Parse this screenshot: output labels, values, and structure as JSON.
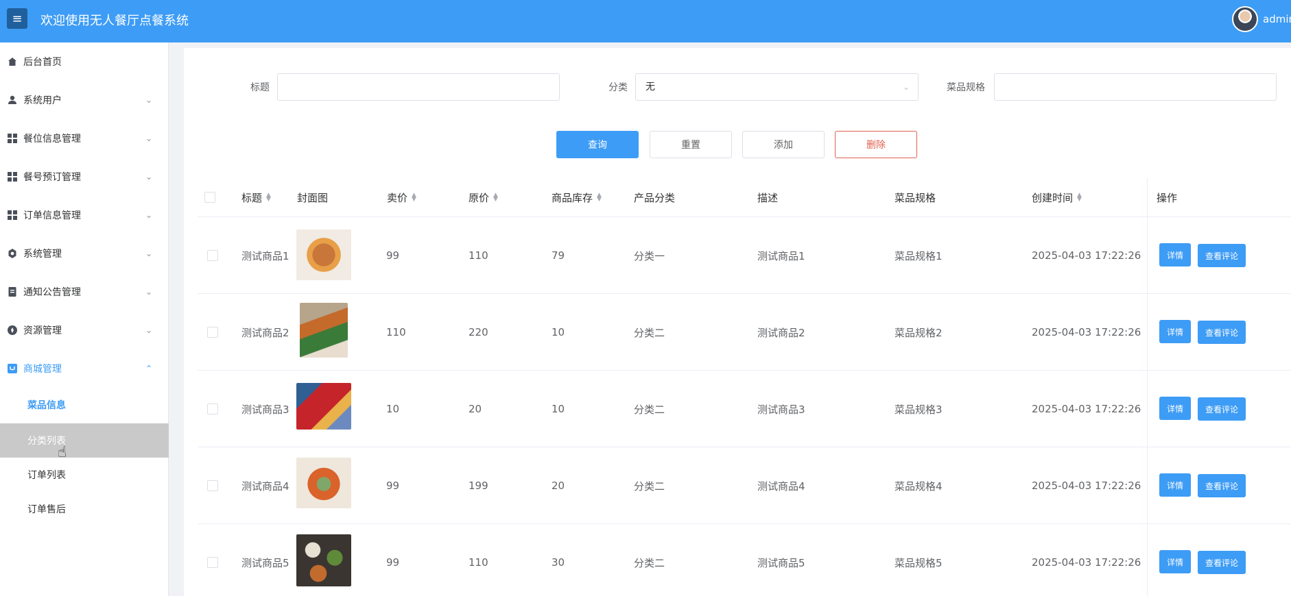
{
  "header": {
    "title": "欢迎使用无人餐厅点餐系统",
    "user": "admin",
    "menu_icon": "hamburger-icon"
  },
  "sidebar": {
    "items": [
      {
        "label": "后台首页",
        "icon": "home-icon",
        "expand": ""
      },
      {
        "label": "系统用户",
        "icon": "user-icon",
        "expand": "⌄"
      },
      {
        "label": "餐位信息管理",
        "icon": "grid-icon",
        "expand": "⌄"
      },
      {
        "label": "餐号预订管理",
        "icon": "grid-icon",
        "expand": "⌄"
      },
      {
        "label": "订单信息管理",
        "icon": "grid-icon",
        "expand": "⌄"
      },
      {
        "label": "系统管理",
        "icon": "gear-icon",
        "expand": "⌄"
      },
      {
        "label": "通知公告管理",
        "icon": "document-icon",
        "expand": "⌄"
      },
      {
        "label": "资源管理",
        "icon": "compass-icon",
        "expand": "⌄"
      },
      {
        "label": "商城管理",
        "icon": "shop-icon",
        "expand": "⌃"
      }
    ],
    "sub_items": [
      {
        "label": "菜品信息"
      },
      {
        "label": "分类列表"
      },
      {
        "label": "订单列表"
      },
      {
        "label": "订单售后"
      }
    ]
  },
  "filters": {
    "title_label": "标题",
    "title_value": "",
    "category_label": "分类",
    "category_value": "无",
    "spec_label": "菜品规格",
    "spec_value": ""
  },
  "actions": {
    "query": "查询",
    "reset": "重置",
    "add": "添加",
    "delete": "删除"
  },
  "table": {
    "columns": [
      "标题",
      "封面图",
      "卖价",
      "原价",
      "商品库存",
      "产品分类",
      "描述",
      "菜品规格",
      "创建时间",
      "操作"
    ],
    "rows": [
      {
        "title": "测试商品1",
        "price": "99",
        "orig": "110",
        "stock": "79",
        "category": "分类一",
        "desc": "测试商品1",
        "spec": "菜品规格1",
        "created": "2025-04-03 17:22:26"
      },
      {
        "title": "测试商品2",
        "price": "110",
        "orig": "220",
        "stock": "10",
        "category": "分类二",
        "desc": "测试商品2",
        "spec": "菜品规格2",
        "created": "2025-04-03 17:22:26"
      },
      {
        "title": "测试商品3",
        "price": "10",
        "orig": "20",
        "stock": "10",
        "category": "分类二",
        "desc": "测试商品3",
        "spec": "菜品规格3",
        "created": "2025-04-03 17:22:26"
      },
      {
        "title": "测试商品4",
        "price": "99",
        "orig": "199",
        "stock": "20",
        "category": "分类二",
        "desc": "测试商品4",
        "spec": "菜品规格4",
        "created": "2025-04-03 17:22:26"
      },
      {
        "title": "测试商品5",
        "price": "99",
        "orig": "110",
        "stock": "30",
        "category": "分类二",
        "desc": "测试商品5",
        "spec": "菜品规格5",
        "created": "2025-04-03 17:22:26"
      }
    ],
    "row_actions": {
      "detail": "详情",
      "comments": "查看评论"
    }
  },
  "colors": {
    "accent": "#3d9cf5",
    "danger": "#e0604f",
    "hover": "#c9c9c9"
  }
}
